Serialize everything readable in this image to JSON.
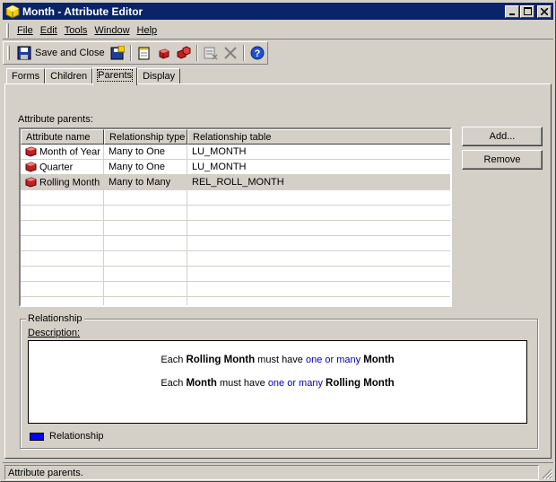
{
  "window": {
    "title": "Month - Attribute Editor"
  },
  "menu": [
    "File",
    "Edit",
    "Tools",
    "Window",
    "Help"
  ],
  "toolbar": {
    "save_close_label": "Save and Close"
  },
  "tabs": [
    {
      "label": "Forms",
      "active": false
    },
    {
      "label": "Children",
      "active": false
    },
    {
      "label": "Parents",
      "active": true
    },
    {
      "label": "Display",
      "active": false
    }
  ],
  "parents": {
    "section_label": "Attribute parents:",
    "columns": [
      "Attribute name",
      "Relationship type",
      "Relationship table"
    ],
    "rows": [
      {
        "name": "Month of Year",
        "type": "Many to One",
        "table": "LU_MONTH",
        "selected": false
      },
      {
        "name": "Quarter",
        "type": "Many to One",
        "table": "LU_MONTH",
        "selected": false
      },
      {
        "name": "Rolling Month",
        "type": "Many to Many",
        "table": "REL_ROLL_MONTH",
        "selected": true
      }
    ],
    "add_label": "Add...",
    "remove_label": "Remove"
  },
  "relationship": {
    "group_title": "Relationship",
    "description_label": "Description:",
    "line1": {
      "pre": "Each",
      "a": "Rolling Month",
      "mid": "must have",
      "card": "one or many",
      "b": "Month"
    },
    "line2": {
      "pre": "Each",
      "a": "Month",
      "mid": "must have",
      "card": "one or many",
      "b": "Rolling Month"
    },
    "legend_label": "Relationship",
    "legend_color": "#0000ff"
  },
  "status": {
    "text": "Attribute parents."
  },
  "colors": {
    "titlebar": "#0a246a",
    "window_bg": "#d4d0c8",
    "cardinality_text": "#0000c0"
  }
}
